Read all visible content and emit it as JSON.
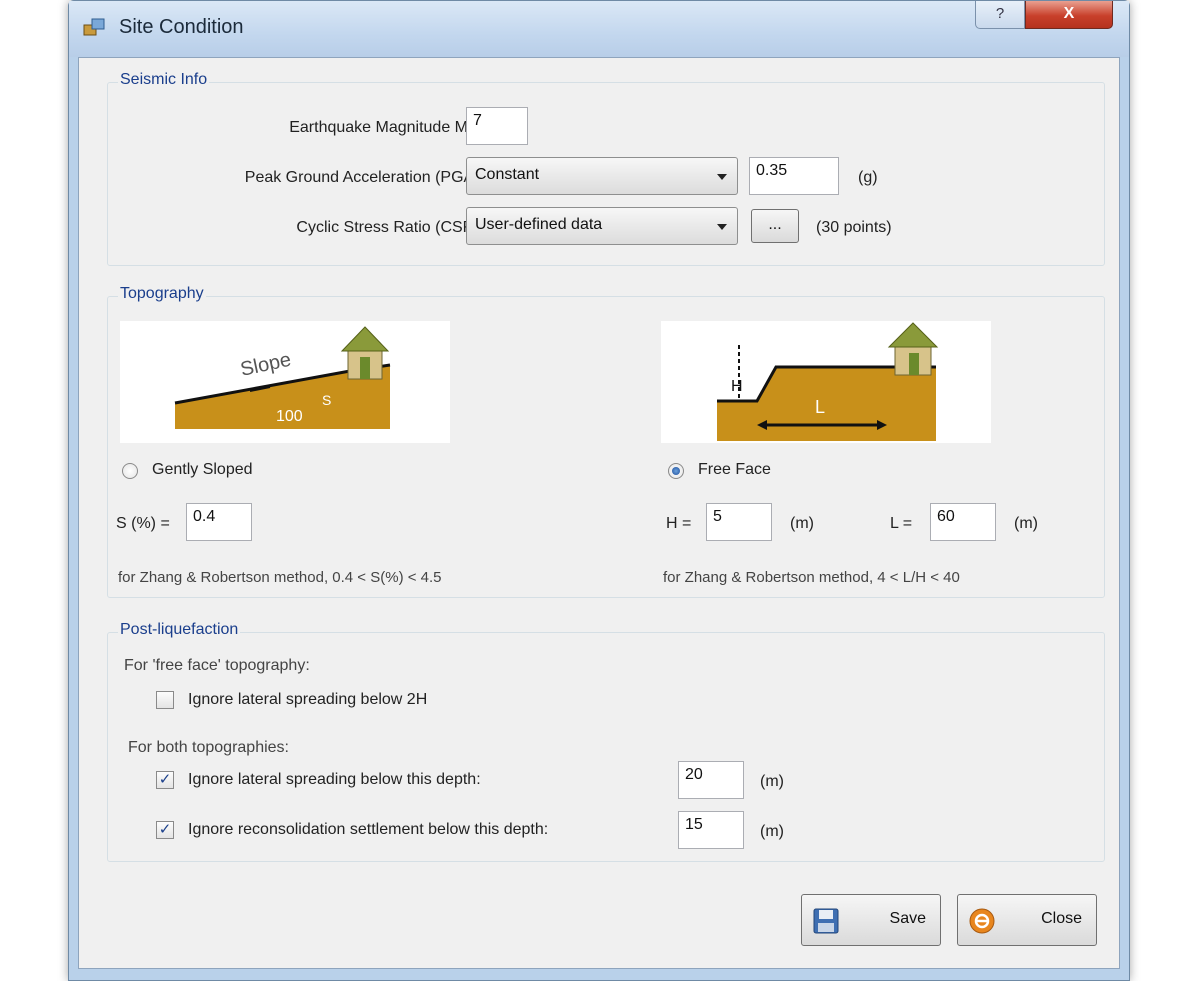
{
  "window": {
    "title": "Site Condition",
    "help_label": "?",
    "close_label": "X"
  },
  "seismic": {
    "group_title": "Seismic Info",
    "magnitude_label": "Earthquake Magnitude Mw:",
    "magnitude_value": "7",
    "pga_label": "Peak Ground Acceleration (PGA):",
    "pga_mode": "Constant",
    "pga_value": "0.35",
    "pga_unit": "(g)",
    "csr_label": "Cyclic Stress Ratio (CSR):",
    "csr_mode": "User-defined data",
    "csr_button_label": "...",
    "csr_points": "(30 points)"
  },
  "topography": {
    "group_title": "Topography",
    "gently_sloped": {
      "illustration": {
        "slope_text": "Slope",
        "run_value": "100",
        "rise_value": "S"
      },
      "option_label": "Gently Sloped",
      "selected": false,
      "s_label": "S (%) =",
      "s_value": "0.4",
      "note": "for Zhang & Robertson method, 0.4 < S(%) < 4.5"
    },
    "free_face": {
      "illustration": {
        "height_label": "H",
        "length_label": "L"
      },
      "option_label": "Free Face",
      "selected": true,
      "h_label": "H =",
      "h_value": "5",
      "h_unit": "(m)",
      "l_label": "L =",
      "l_value": "60",
      "l_unit": "(m)",
      "note": "for Zhang & Robertson method, 4 < L/H < 40"
    }
  },
  "post_liquefaction": {
    "group_title": "Post-liquefaction",
    "free_face_heading": "For 'free face' topography:",
    "ignore_2h_label": "Ignore lateral spreading below 2H",
    "ignore_2h_checked": false,
    "both_heading": "For both topographies:",
    "lateral_label": "Ignore lateral spreading below this depth:",
    "lateral_checked": true,
    "lateral_value": "20",
    "lateral_unit": "(m)",
    "reconsolidation_label": "Ignore reconsolidation settlement below this depth:",
    "reconsolidation_checked": true,
    "reconsolidation_value": "15",
    "reconsolidation_unit": "(m)"
  },
  "footer": {
    "save_label": "Save",
    "close_label": "Close"
  },
  "icons": {
    "app": "app-icon",
    "save": "floppy-disk-icon",
    "close": "close-circle-icon"
  },
  "colors": {
    "group_title": "#1a3e8c",
    "soil": "#c8901a",
    "close_button": "#c8402b"
  }
}
